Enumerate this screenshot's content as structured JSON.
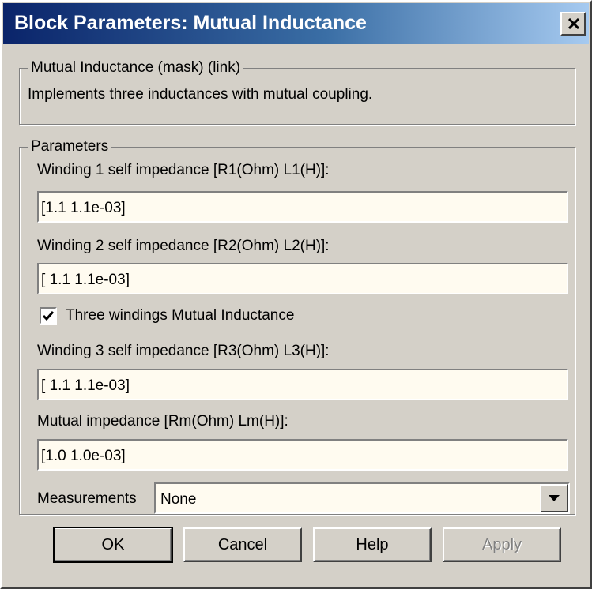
{
  "window": {
    "title": "Block Parameters: Mutual Inductance",
    "close_glyph": "close-icon"
  },
  "mask_group": {
    "legend": "Mutual Inductance (mask) (link)",
    "description": "Implements three inductances with mutual coupling."
  },
  "params_group": {
    "legend": "Parameters",
    "winding1": {
      "label": "Winding 1 self impedance [R1(Ohm) L1(H)]:",
      "value": "[1.1 1.1e-03]"
    },
    "winding2": {
      "label": "Winding 2 self impedance [R2(Ohm) L2(H)]:",
      "value": "[ 1.1 1.1e-03]"
    },
    "three_windings": {
      "label": "Three windings Mutual Inductance",
      "checked": true
    },
    "winding3": {
      "label": "Winding 3 self impedance [R3(Ohm) L3(H)]:",
      "value": "[ 1.1 1.1e-03]"
    },
    "mutual": {
      "label": "Mutual impedance [Rm(Ohm) Lm(H)]:",
      "value": "[1.0 1.0e-03]"
    },
    "measurements": {
      "label": "Measurements",
      "value": "None"
    }
  },
  "buttons": {
    "ok": "OK",
    "cancel": "Cancel",
    "help": "Help",
    "apply": "Apply"
  },
  "colors": {
    "title_start": "#0a246a",
    "title_end": "#a6caf0",
    "face": "#d4d0c8",
    "field_bg": "#fffbf0"
  }
}
